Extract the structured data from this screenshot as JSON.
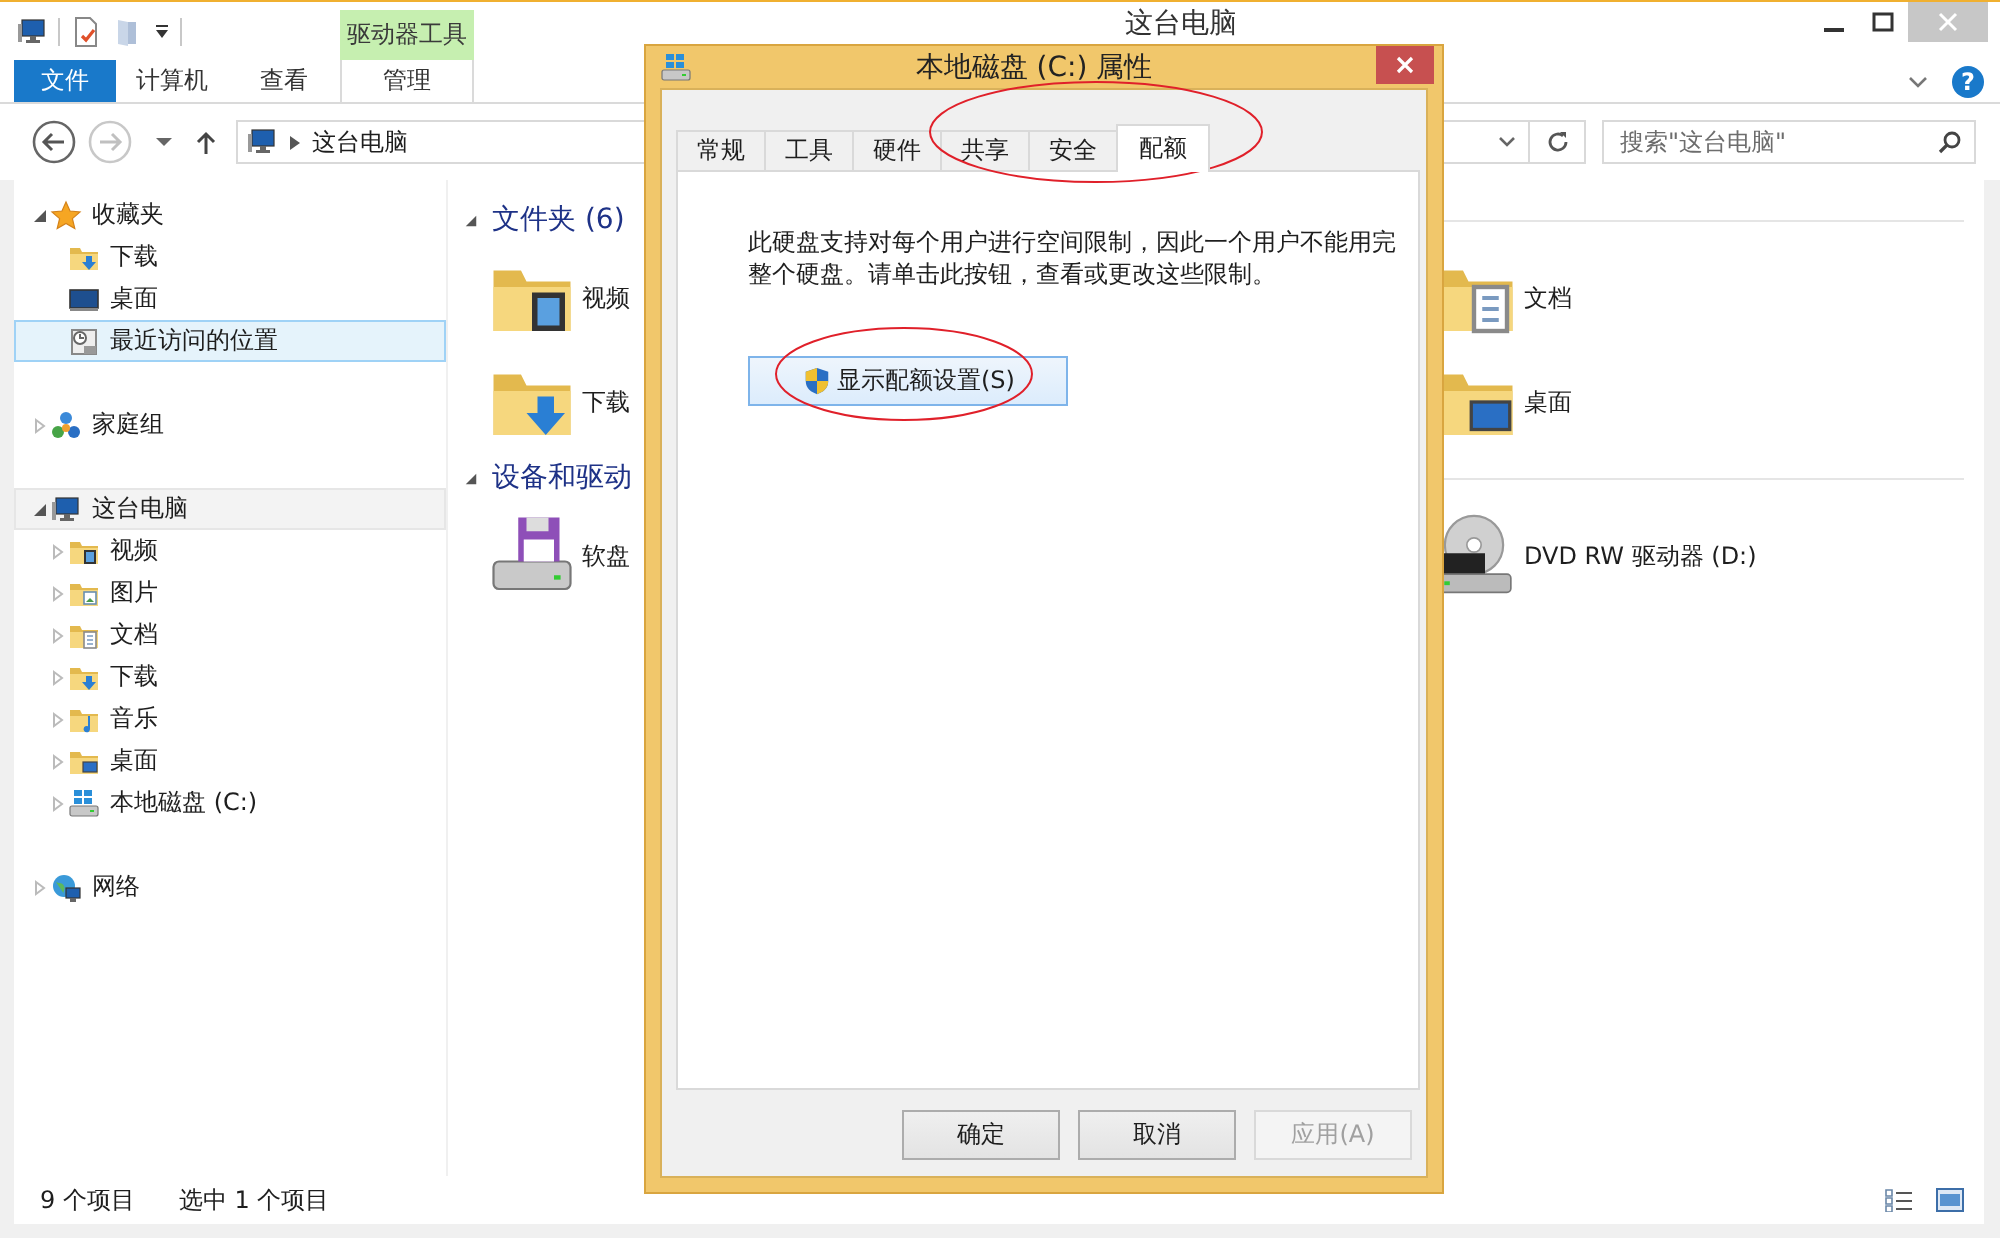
{
  "window": {
    "title": "这台电脑"
  },
  "ribbon": {
    "context_group": "驱动器工具",
    "help": "?",
    "tabs": [
      {
        "label": "文件",
        "kind": "file"
      },
      {
        "label": "计算机",
        "kind": "tab"
      },
      {
        "label": "查看",
        "kind": "tab"
      },
      {
        "label": "管理",
        "kind": "context"
      }
    ]
  },
  "address": {
    "location": "这台电脑"
  },
  "search": {
    "placeholder": "搜索\"这台电脑\""
  },
  "sidebar": {
    "items": [
      {
        "label": "收藏夹",
        "kind": "favorites",
        "expanded": true,
        "selected": false,
        "hovered": false,
        "children": [
          {
            "label": "下载",
            "kind": "download",
            "selected": false,
            "hovered": false
          },
          {
            "label": "桌面",
            "kind": "desktop",
            "selected": false,
            "hovered": false
          },
          {
            "label": "最近访问的位置",
            "kind": "recent",
            "selected": true,
            "hovered": false
          }
        ]
      },
      {
        "label": "家庭组",
        "kind": "homegroup",
        "expanded": false,
        "selected": false,
        "hovered": false
      },
      {
        "label": "这台电脑",
        "kind": "computer",
        "expanded": true,
        "selected": false,
        "hovered": true,
        "children": [
          {
            "label": "视频",
            "kind": "video",
            "expanded": false,
            "selected": false,
            "hovered": false
          },
          {
            "label": "图片",
            "kind": "pictures",
            "expanded": false,
            "selected": false,
            "hovered": false
          },
          {
            "label": "文档",
            "kind": "documents",
            "expanded": false,
            "selected": false,
            "hovered": false
          },
          {
            "label": "下载",
            "kind": "download",
            "expanded": false,
            "selected": false,
            "hovered": false
          },
          {
            "label": "音乐",
            "kind": "music",
            "expanded": false,
            "selected": false,
            "hovered": false
          },
          {
            "label": "桌面",
            "kind": "desktop-folder",
            "expanded": false,
            "selected": false,
            "hovered": false
          },
          {
            "label": "本地磁盘 (C:)",
            "kind": "drive",
            "expanded": false,
            "selected": false,
            "hovered": false
          }
        ]
      },
      {
        "label": "网络",
        "kind": "network",
        "expanded": false,
        "selected": false,
        "hovered": false
      }
    ]
  },
  "content": {
    "groups": [
      {
        "title": "文件夹 (6)",
        "expanded": true,
        "items": [
          {
            "name": "视频",
            "kind": "video"
          },
          {
            "name": "文档",
            "kind": "documents"
          },
          {
            "name": "下载",
            "kind": "download"
          },
          {
            "name": "桌面",
            "kind": "desktop-folder"
          }
        ]
      },
      {
        "title": "设备和驱动",
        "expanded": true,
        "items": [
          {
            "name": "软盘",
            "kind": "floppy"
          },
          {
            "name": "DVD RW 驱动器 (D:)",
            "kind": "dvd"
          }
        ]
      }
    ]
  },
  "status_bar": {
    "count": "9 个项目",
    "selection": "选中 1 个项目"
  },
  "dialog": {
    "title": "本地磁盘 (C:) 属性",
    "tabs": [
      {
        "label": "常规",
        "selected": false
      },
      {
        "label": "工具",
        "selected": false
      },
      {
        "label": "硬件",
        "selected": false
      },
      {
        "label": "共享",
        "selected": false
      },
      {
        "label": "安全",
        "selected": false
      },
      {
        "label": "配额",
        "selected": true
      }
    ],
    "description": "此硬盘支持对每个用户进行空间限制，因此一个用户不能用完整个硬盘。请单击此按钮，查看或更改这些限制。",
    "quota_button": {
      "label": "显示配额设置(S)",
      "focused": true
    },
    "buttons": [
      {
        "label": "确定",
        "disabled": false
      },
      {
        "label": "取消",
        "disabled": false
      },
      {
        "label": "应用(A)",
        "disabled": true
      }
    ]
  }
}
